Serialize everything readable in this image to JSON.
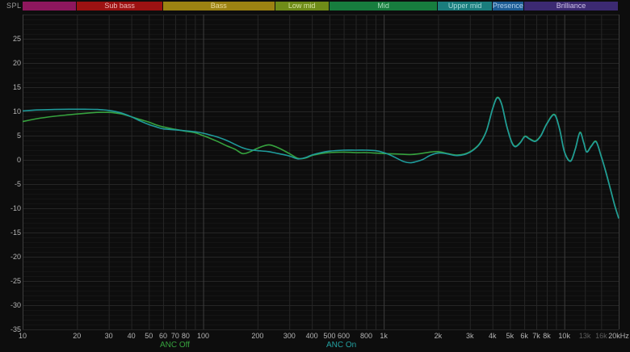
{
  "spl_label": "SPL",
  "bands": [
    {
      "label": "",
      "f_start": 10,
      "f_end": 20,
      "color": "#8e175e",
      "text_color": "#e3b1cf"
    },
    {
      "label": "Sub bass",
      "f_start": 20,
      "f_end": 60,
      "color": "#9c1212",
      "text_color": "#edb9b9"
    },
    {
      "label": "Bass",
      "f_start": 60,
      "f_end": 250,
      "color": "#9c8212",
      "text_color": "#e9da9d"
    },
    {
      "label": "Low mid",
      "f_start": 250,
      "f_end": 500,
      "color": "#6f8c18",
      "text_color": "#d7e4a5"
    },
    {
      "label": "Mid",
      "f_start": 500,
      "f_end": 2000,
      "color": "#177d3e",
      "text_color": "#a9ddbb"
    },
    {
      "label": "Upper mid",
      "f_start": 2000,
      "f_end": 4000,
      "color": "#1a7d7d",
      "text_color": "#a9dcdc"
    },
    {
      "label": "Presence",
      "f_start": 4000,
      "f_end": 6000,
      "color": "#1d5c94",
      "text_color": "#b2d0ec"
    },
    {
      "label": "Brilliance",
      "f_start": 6000,
      "f_end": 20000,
      "color": "#3c2a72",
      "text_color": "#cfc2ea"
    }
  ],
  "chart_data": {
    "type": "line",
    "title": "",
    "ylabel": "SPL",
    "x_scale": "log",
    "xlim": [
      10,
      20000
    ],
    "ylim": [
      -35,
      30
    ],
    "grid": true,
    "y_tick_labels": [
      25,
      20,
      15,
      10,
      5,
      0,
      -5,
      -10,
      -15,
      -20,
      -25,
      -30,
      -35
    ],
    "y_major_step": 5,
    "y_minor_step": 1,
    "x_ticks": [
      {
        "f": 10,
        "label": "10"
      },
      {
        "f": 20,
        "label": "20"
      },
      {
        "f": 30,
        "label": "30"
      },
      {
        "f": 40,
        "label": "40"
      },
      {
        "f": 50,
        "label": "50"
      },
      {
        "f": 60,
        "label": "60"
      },
      {
        "f": 70,
        "label": "70"
      },
      {
        "f": 80,
        "label": "80"
      },
      {
        "f": 100,
        "label": "100"
      },
      {
        "f": 200,
        "label": "200"
      },
      {
        "f": 300,
        "label": "300"
      },
      {
        "f": 400,
        "label": "400"
      },
      {
        "f": 500,
        "label": "500"
      },
      {
        "f": 600,
        "label": "600"
      },
      {
        "f": 800,
        "label": "800"
      },
      {
        "f": 1000,
        "label": "1k"
      },
      {
        "f": 2000,
        "label": "2k"
      },
      {
        "f": 3000,
        "label": "3k"
      },
      {
        "f": 4000,
        "label": "4k"
      },
      {
        "f": 5000,
        "label": "5k"
      },
      {
        "f": 6000,
        "label": "6k"
      },
      {
        "f": 7000,
        "label": "7k"
      },
      {
        "f": 8000,
        "label": "8k"
      },
      {
        "f": 10000,
        "label": "10k"
      },
      {
        "f": 13000,
        "label": "13k",
        "dim": true
      },
      {
        "f": 16000,
        "label": "16k",
        "dim": true
      },
      {
        "f": 20000,
        "label": "20kHz"
      }
    ],
    "x_grid_major": [
      10,
      100,
      1000,
      10000,
      20000
    ],
    "x_grid_minor": [
      20,
      30,
      40,
      50,
      60,
      70,
      80,
      90,
      200,
      300,
      400,
      500,
      600,
      700,
      800,
      900,
      2000,
      3000,
      4000,
      5000,
      6000,
      7000,
      8000,
      9000,
      13000,
      16000
    ],
    "legend": [
      {
        "label": "ANC Off",
        "color": "#36a23e"
      },
      {
        "label": "ANC On",
        "color": "#23a0a0"
      }
    ],
    "series": [
      {
        "name": "ANC Off",
        "color": "#36a23e",
        "points": [
          [
            10,
            7.9
          ],
          [
            12,
            8.5
          ],
          [
            15,
            9.0
          ],
          [
            18,
            9.3
          ],
          [
            22,
            9.6
          ],
          [
            26,
            9.8
          ],
          [
            30,
            9.8
          ],
          [
            35,
            9.5
          ],
          [
            40,
            8.9
          ],
          [
            45,
            8.3
          ],
          [
            50,
            7.8
          ],
          [
            55,
            7.2
          ],
          [
            60,
            6.8
          ],
          [
            70,
            6.3
          ],
          [
            80,
            5.9
          ],
          [
            90,
            5.6
          ],
          [
            100,
            5.0
          ],
          [
            110,
            4.4
          ],
          [
            120,
            3.8
          ],
          [
            135,
            2.9
          ],
          [
            150,
            2.2
          ],
          [
            165,
            1.3
          ],
          [
            180,
            1.6
          ],
          [
            200,
            2.4
          ],
          [
            230,
            3.1
          ],
          [
            260,
            2.5
          ],
          [
            300,
            1.3
          ],
          [
            335,
            0.3
          ],
          [
            370,
            0.4
          ],
          [
            400,
            0.9
          ],
          [
            450,
            1.3
          ],
          [
            500,
            1.5
          ],
          [
            600,
            1.6
          ],
          [
            700,
            1.5
          ],
          [
            800,
            1.5
          ],
          [
            900,
            1.4
          ],
          [
            1000,
            1.3
          ],
          [
            1200,
            1.2
          ],
          [
            1400,
            1.1
          ],
          [
            1600,
            1.3
          ],
          [
            1800,
            1.6
          ],
          [
            2000,
            1.7
          ],
          [
            2200,
            1.4
          ],
          [
            2500,
            1.0
          ],
          [
            2800,
            1.2
          ],
          [
            3100,
            2.0
          ],
          [
            3400,
            3.4
          ],
          [
            3700,
            6.0
          ],
          [
            4000,
            10.5
          ],
          [
            4250,
            12.9
          ],
          [
            4500,
            11.5
          ],
          [
            4800,
            7.0
          ],
          [
            5100,
            3.8
          ],
          [
            5350,
            2.8
          ],
          [
            5700,
            3.6
          ],
          [
            6050,
            4.9
          ],
          [
            6400,
            4.4
          ],
          [
            6900,
            3.9
          ],
          [
            7400,
            5.0
          ],
          [
            8000,
            7.5
          ],
          [
            8800,
            9.4
          ],
          [
            9400,
            6.5
          ],
          [
            10000,
            1.8
          ],
          [
            10800,
            -0.2
          ],
          [
            11500,
            2.3
          ],
          [
            12200,
            5.7
          ],
          [
            12800,
            3.6
          ],
          [
            13300,
            1.7
          ],
          [
            14100,
            2.9
          ],
          [
            15000,
            3.8
          ],
          [
            16000,
            0.8
          ],
          [
            17000,
            -2.5
          ],
          [
            18000,
            -6.0
          ],
          [
            19000,
            -9.3
          ],
          [
            20000,
            -12.0
          ]
        ]
      },
      {
        "name": "ANC On",
        "color": "#1f9b9b",
        "points": [
          [
            10,
            10.1
          ],
          [
            12,
            10.3
          ],
          [
            15,
            10.4
          ],
          [
            18,
            10.45
          ],
          [
            22,
            10.45
          ],
          [
            26,
            10.4
          ],
          [
            30,
            10.2
          ],
          [
            35,
            9.7
          ],
          [
            40,
            8.9
          ],
          [
            45,
            8.0
          ],
          [
            50,
            7.3
          ],
          [
            55,
            6.8
          ],
          [
            60,
            6.4
          ],
          [
            70,
            6.2
          ],
          [
            80,
            6.0
          ],
          [
            90,
            5.8
          ],
          [
            100,
            5.5
          ],
          [
            110,
            5.1
          ],
          [
            120,
            4.7
          ],
          [
            135,
            4.0
          ],
          [
            150,
            3.2
          ],
          [
            165,
            2.5
          ],
          [
            180,
            2.1
          ],
          [
            200,
            1.9
          ],
          [
            230,
            1.7
          ],
          [
            260,
            1.3
          ],
          [
            300,
            0.8
          ],
          [
            335,
            0.2
          ],
          [
            370,
            0.5
          ],
          [
            400,
            1.0
          ],
          [
            450,
            1.5
          ],
          [
            500,
            1.8
          ],
          [
            600,
            2.0
          ],
          [
            700,
            2.0
          ],
          [
            800,
            2.0
          ],
          [
            900,
            1.9
          ],
          [
            1000,
            1.5
          ],
          [
            1100,
            0.9
          ],
          [
            1200,
            0.2
          ],
          [
            1300,
            -0.4
          ],
          [
            1400,
            -0.6
          ],
          [
            1500,
            -0.4
          ],
          [
            1650,
            0.1
          ],
          [
            1800,
            0.9
          ],
          [
            2000,
            1.4
          ],
          [
            2200,
            1.3
          ],
          [
            2500,
            0.9
          ],
          [
            2800,
            1.1
          ],
          [
            3100,
            1.9
          ],
          [
            3400,
            3.3
          ],
          [
            3700,
            5.9
          ],
          [
            4000,
            10.4
          ],
          [
            4250,
            12.8
          ],
          [
            4500,
            11.4
          ],
          [
            4800,
            6.9
          ],
          [
            5100,
            3.7
          ],
          [
            5350,
            2.7
          ],
          [
            5700,
            3.5
          ],
          [
            6050,
            4.8
          ],
          [
            6400,
            4.3
          ],
          [
            6900,
            3.8
          ],
          [
            7400,
            4.9
          ],
          [
            8000,
            7.4
          ],
          [
            8800,
            9.3
          ],
          [
            9400,
            6.4
          ],
          [
            10000,
            1.7
          ],
          [
            10800,
            -0.3
          ],
          [
            11500,
            2.2
          ],
          [
            12200,
            5.6
          ],
          [
            12800,
            3.5
          ],
          [
            13300,
            1.6
          ],
          [
            14100,
            2.8
          ],
          [
            15000,
            3.7
          ],
          [
            16000,
            0.7
          ],
          [
            17000,
            -2.6
          ],
          [
            18000,
            -6.1
          ],
          [
            19000,
            -9.4
          ],
          [
            20000,
            -12.1
          ]
        ]
      }
    ],
    "colors": {
      "background": "#0d0d0d",
      "grid_minor_h": "#151515",
      "grid_major_h": "#262626",
      "grid_minor_v": "#262626",
      "grid_major_v": "#3d3d3d",
      "tick_label": "#b5b5b5",
      "tick_label_dim": "#5e5e5e"
    }
  }
}
